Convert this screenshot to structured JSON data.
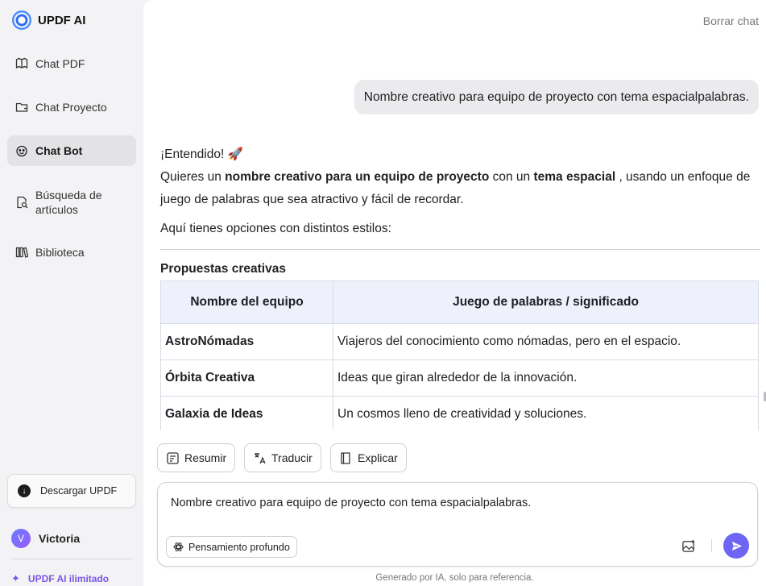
{
  "brand": {
    "name": "UPDF AI"
  },
  "sidebar": {
    "items": [
      {
        "label": "Chat PDF",
        "icon": "book-open-icon",
        "active": false
      },
      {
        "label": "Chat Proyecto",
        "icon": "folder-icon",
        "active": false
      },
      {
        "label": "Chat Bot",
        "icon": "bot-icon",
        "active": true
      },
      {
        "label": "Búsqueda de artículos",
        "icon": "search-doc-icon",
        "active": false
      },
      {
        "label": "Biblioteca",
        "icon": "library-icon",
        "active": false
      }
    ],
    "download_label": "Descargar UPDF",
    "user": {
      "initial": "V",
      "name": "Victoria"
    },
    "plan_label": "UPDF AI ilimitado"
  },
  "header": {
    "clear_chat": "Borrar chat"
  },
  "conversation": {
    "user_message": "Nombre creativo para equipo de proyecto con tema espacialpalabras.",
    "answer": {
      "greeting": "¡Entendido! 🚀",
      "intro_pre": "Quieres un ",
      "intro_bold1": "nombre creativo para un equipo de proyecto",
      "intro_mid": " con un ",
      "intro_bold2": "tema espacial",
      "intro_post": " , usando un enfoque de juego de palabras que sea atractivo y fácil de recordar.",
      "options_line": "Aquí tienes opciones con distintos estilos:",
      "section_title": "Propuestas creativas",
      "table": {
        "headers": [
          "Nombre del equipo",
          "Juego de palabras / significado"
        ],
        "rows": [
          [
            "AstroNómadas",
            "Viajeros del conocimiento como nómadas, pero en el espacio."
          ],
          [
            "Órbita Creativa",
            "Ideas que giran alrededor de la innovación."
          ],
          [
            "Galaxia de Ideas",
            "Un cosmos lleno de creatividad y soluciones."
          ]
        ]
      }
    }
  },
  "actions": {
    "summarize": "Resumir",
    "translate": "Traducir",
    "explain": "Explicar"
  },
  "composer": {
    "value": "Nombre creativo para equipo de proyecto con tema espacialpalabras.",
    "deep_thinking": "Pensamiento profundo"
  },
  "footnote": "Generado por IA, solo para referencia.",
  "colors": {
    "accent": "#6f65f5",
    "plan": "#7b55e6",
    "table_header": "#eef0fb"
  }
}
